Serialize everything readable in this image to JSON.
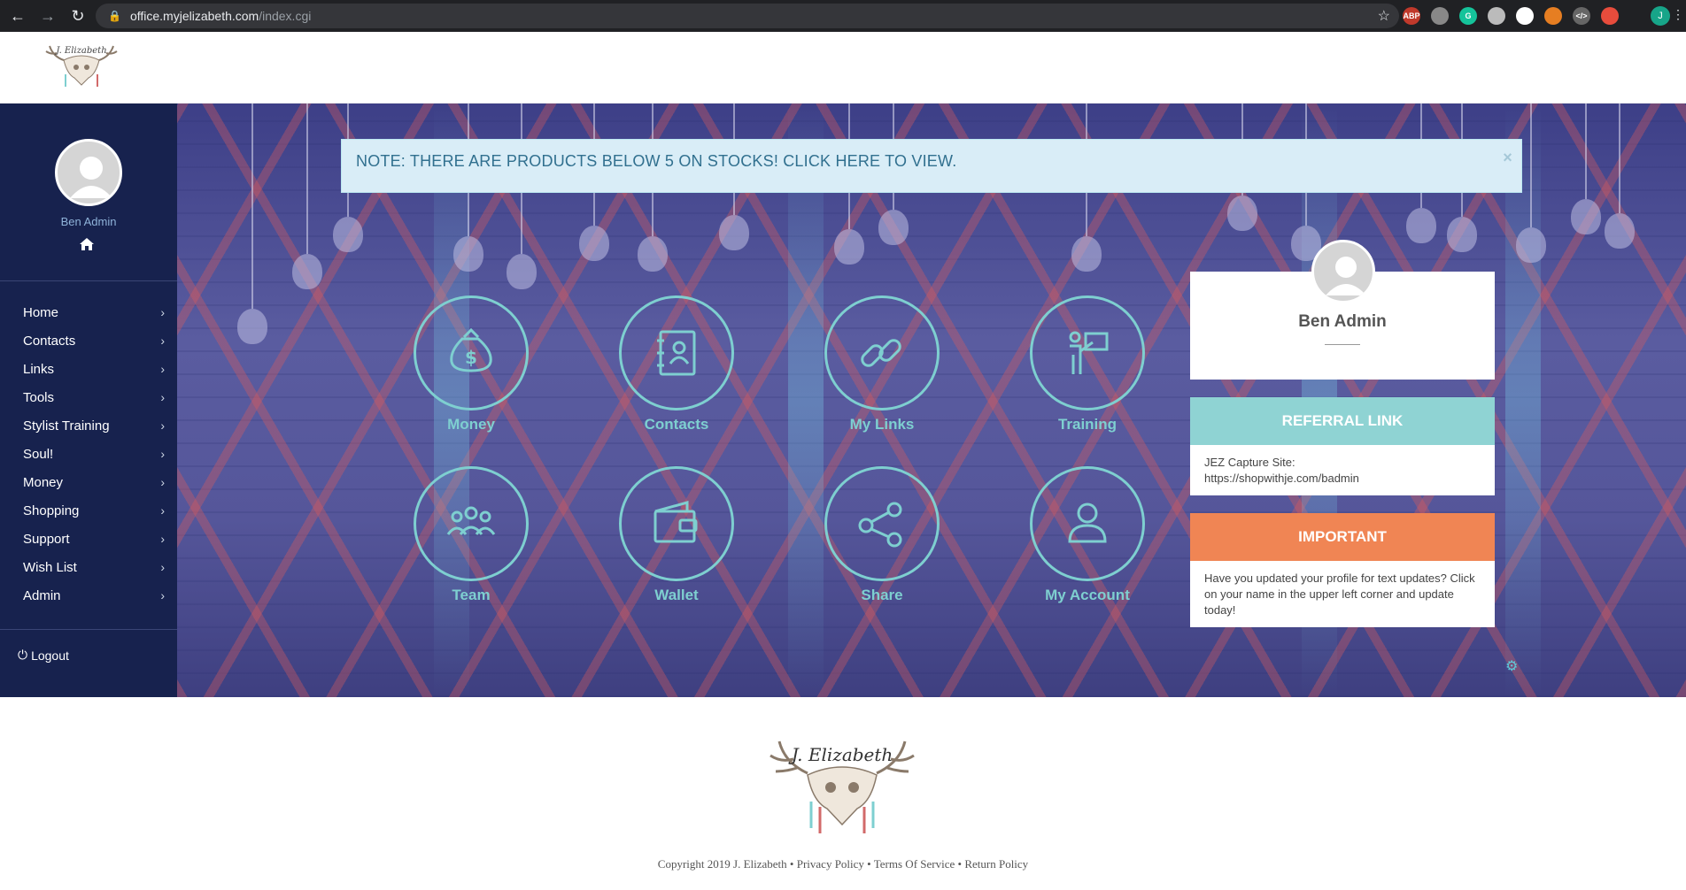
{
  "browser": {
    "url_host": "office.myjelizabeth.com",
    "url_path": "/index.cgi",
    "profile_initial": "J",
    "extensions": [
      {
        "name": "abp-icon",
        "text": "ABP",
        "color": "#c0392b"
      },
      {
        "name": "camera-icon",
        "text": "",
        "color": "#888888"
      },
      {
        "name": "grammarly-icon",
        "text": "G",
        "color": "#15c39a"
      },
      {
        "name": "clock-icon",
        "text": "",
        "color": "#bbbbbb"
      },
      {
        "name": "feather-icon",
        "text": "",
        "color": "#ffffff"
      },
      {
        "name": "chrome-ext-icon",
        "text": "",
        "color": "#e67e22"
      },
      {
        "name": "code-icon",
        "text": "</>",
        "color": "#666666"
      },
      {
        "name": "lastpass-icon",
        "text": "",
        "color": "#e74c3c"
      }
    ]
  },
  "sidebar": {
    "user_name": "Ben Admin",
    "items": [
      {
        "label": "Home"
      },
      {
        "label": "Contacts"
      },
      {
        "label": "Links"
      },
      {
        "label": "Tools"
      },
      {
        "label": "Stylist Training"
      },
      {
        "label": "Soul!"
      },
      {
        "label": "Money"
      },
      {
        "label": "Shopping"
      },
      {
        "label": "Support"
      },
      {
        "label": "Wish List"
      },
      {
        "label": "Admin"
      }
    ],
    "logout_label": "Logout"
  },
  "alert": {
    "text": "NOTE: THERE ARE PRODUCTS BELOW 5 ON STOCKS! CLICK HERE TO VIEW.",
    "close": "×"
  },
  "tiles": [
    {
      "label": "Money",
      "icon": "money-bag-icon"
    },
    {
      "label": "Contacts",
      "icon": "address-book-icon"
    },
    {
      "label": "My Links",
      "icon": "link-icon"
    },
    {
      "label": "Training",
      "icon": "presentation-icon"
    },
    {
      "label": "Team",
      "icon": "team-icon"
    },
    {
      "label": "Wallet",
      "icon": "wallet-icon"
    },
    {
      "label": "Share",
      "icon": "share-icon"
    },
    {
      "label": "My Account",
      "icon": "user-icon"
    }
  ],
  "profile_card": {
    "name": "Ben Admin"
  },
  "referral": {
    "heading": "REFERRAL LINK",
    "line1": "JEZ Capture Site:",
    "line2": "https://shopwithje.com/badmin",
    "color": "#8fd3d3"
  },
  "important": {
    "heading": "IMPORTANT",
    "text": "Have you updated your profile for text updates? Click on your name in the upper left corner and update today!",
    "color": "#f08554"
  },
  "footer": {
    "copyright": "Copyright 2019 J. Elizabeth",
    "links": [
      "Privacy Policy",
      "Terms Of Service",
      "Return Policy"
    ],
    "separator": "•",
    "logo_text": "J. Elizabeth"
  }
}
